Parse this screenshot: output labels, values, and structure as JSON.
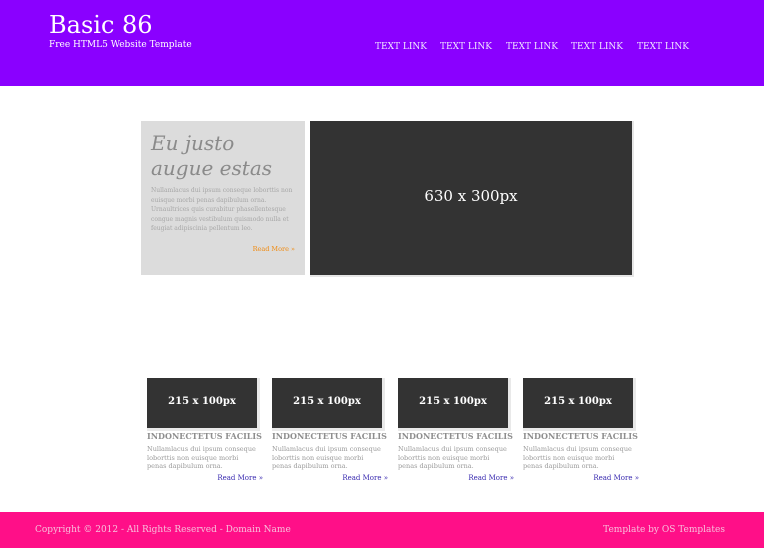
{
  "header": {
    "title": "Basic 86",
    "tagline": "Free HTML5 Website Template",
    "nav": [
      "TEXT LINK",
      "TEXT LINK",
      "TEXT LINK",
      "TEXT LINK",
      "TEXT LINK"
    ],
    "bg_color": "#8a00ff"
  },
  "featured": {
    "title": "Eu justo augue estas",
    "body": "Nullamlacus dui ipsum conseque loborttis non euisque morbi penas dapibulum orna. Urnaultrices quis curabitur phasellentesque congue magnis vestibulum quismodo nulla et feugiat adipiscinia pellentum leo.",
    "read_more": "Read More »",
    "image_label": "630 x 300px"
  },
  "thumbs": [
    {
      "image_label": "215 x 100px",
      "heading": "INDONECTETUS FACILIS",
      "text": "Nullamlacus dui ipsum conseque loborttis non euisque morbi penas dapibulum orna.",
      "read_more": "Read More »"
    },
    {
      "image_label": "215 x 100px",
      "heading": "INDONECTETUS FACILIS",
      "text": "Nullamlacus dui ipsum conseque loborttis non euisque morbi penas dapibulum orna.",
      "read_more": "Read More »"
    },
    {
      "image_label": "215 x 100px",
      "heading": "INDONECTETUS FACILIS",
      "text": "Nullamlacus dui ipsum conseque loborttis non euisque morbi penas dapibulum orna.",
      "read_more": "Read More »"
    },
    {
      "image_label": "215 x 100px",
      "heading": "INDONECTETUS FACILIS",
      "text": "Nullamlacus dui ipsum conseque loborttis non euisque morbi penas dapibulum orna.",
      "read_more": "Read More »"
    }
  ],
  "footer": {
    "copyright": "Copyright © 2012 - All Rights Reserved - Domain Name",
    "credit": "Template by OS Templates",
    "bg_color": "#ff0f88"
  }
}
